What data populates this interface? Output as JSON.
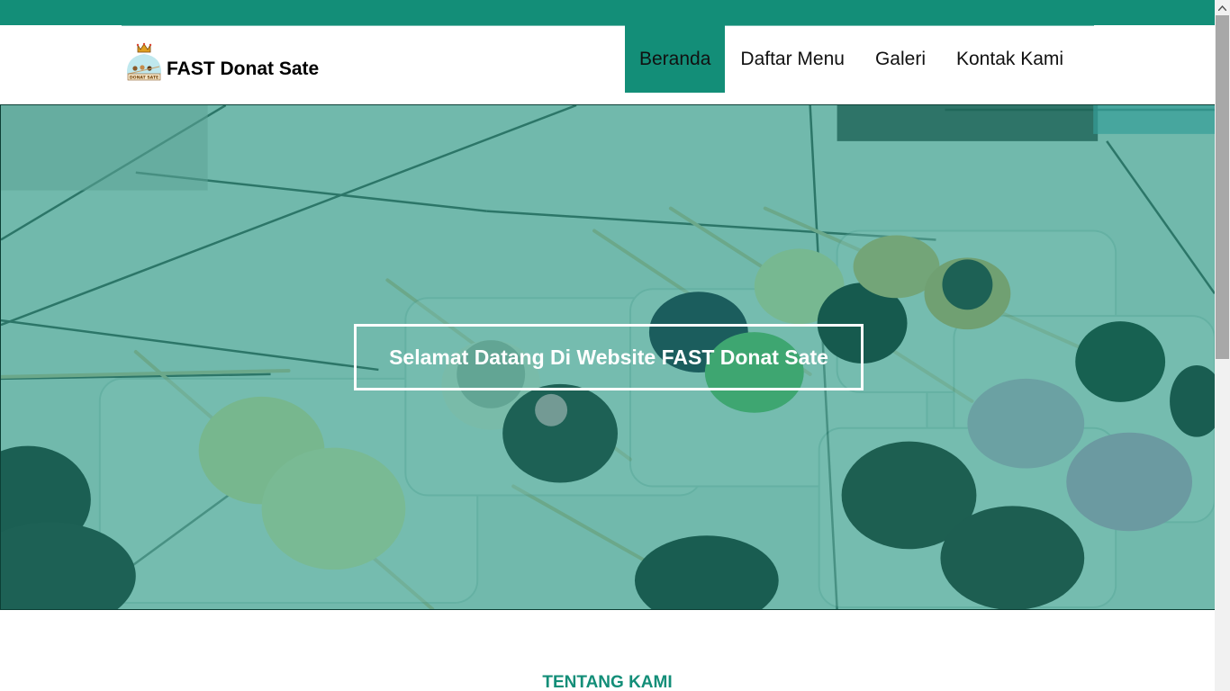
{
  "brand": {
    "name": "FAST Donat Sate",
    "logo_text": "DONAT SATE"
  },
  "nav": {
    "items": [
      {
        "label": "Beranda",
        "active": true
      },
      {
        "label": "Daftar Menu",
        "active": false
      },
      {
        "label": "Galeri",
        "active": false
      },
      {
        "label": "Kontak Kami",
        "active": false
      }
    ]
  },
  "hero": {
    "title": "Selamat Datang Di Website FAST Donat Sate"
  },
  "about": {
    "title": "TENTANG KAMI"
  },
  "colors": {
    "accent": "#138e78",
    "hero_overlay": "#138e78"
  },
  "icons": {
    "logo": "crown-logo-icon",
    "scroll_up": "chevron-up-icon"
  }
}
